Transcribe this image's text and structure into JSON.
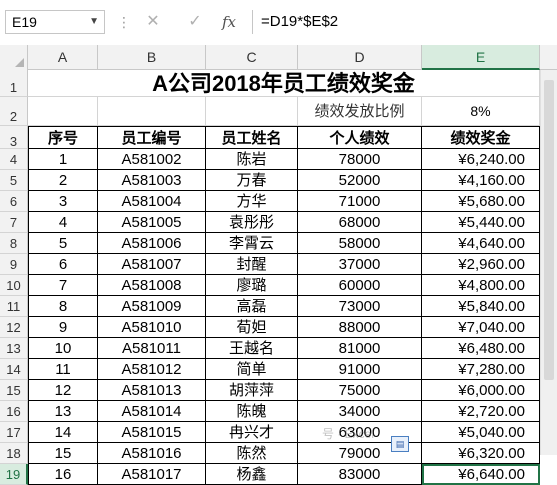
{
  "formula_bar": {
    "name_box": "E19",
    "cancel_glyph": "✕",
    "enter_glyph": "✓",
    "fx_glyph": "fx",
    "formula": "=D19*$E$2"
  },
  "columns": [
    "A",
    "B",
    "C",
    "D",
    "E"
  ],
  "rows": [
    "1",
    "2",
    "3",
    "4",
    "5",
    "6",
    "7",
    "8",
    "9",
    "10",
    "11",
    "12",
    "13",
    "14",
    "15",
    "16",
    "17",
    "18",
    "19"
  ],
  "sheet": {
    "title": "A公司2018年员工绩效奖金",
    "ratio_label": "绩效发放比例",
    "ratio_value": "8%",
    "headers": [
      "序号",
      "员工编号",
      "员工姓名",
      "个人绩效",
      "绩效奖金"
    ],
    "records": [
      [
        "1",
        "A581002",
        "陈岩",
        "78000",
        "¥6,240.00"
      ],
      [
        "2",
        "A581003",
        "万春",
        "52000",
        "¥4,160.00"
      ],
      [
        "3",
        "A581004",
        "方华",
        "71000",
        "¥5,680.00"
      ],
      [
        "4",
        "A581005",
        "袁彤彤",
        "68000",
        "¥5,440.00"
      ],
      [
        "5",
        "A581006",
        "李霄云",
        "58000",
        "¥4,640.00"
      ],
      [
        "6",
        "A581007",
        "封醒",
        "37000",
        "¥2,960.00"
      ],
      [
        "7",
        "A581008",
        "廖璐",
        "60000",
        "¥4,800.00"
      ],
      [
        "8",
        "A581009",
        "高磊",
        "73000",
        "¥5,840.00"
      ],
      [
        "9",
        "A581010",
        "荀妲",
        "88000",
        "¥7,040.00"
      ],
      [
        "10",
        "A581011",
        "王越名",
        "81000",
        "¥6,480.00"
      ],
      [
        "11",
        "A581012",
        "简单",
        "91000",
        "¥7,280.00"
      ],
      [
        "12",
        "A581013",
        "胡萍萍",
        "75000",
        "¥6,000.00"
      ],
      [
        "13",
        "A581014",
        "陈魄",
        "34000",
        "¥2,720.00"
      ],
      [
        "14",
        "A581015",
        "冉兴才",
        "63000",
        "¥5,040.00"
      ],
      [
        "15",
        "A581016",
        "陈然",
        "79000",
        "¥6,320.00"
      ],
      [
        "16",
        "A581017",
        "杨鑫",
        "83000",
        "¥6,640.00"
      ]
    ]
  },
  "watermark": "号 · Excel"
}
